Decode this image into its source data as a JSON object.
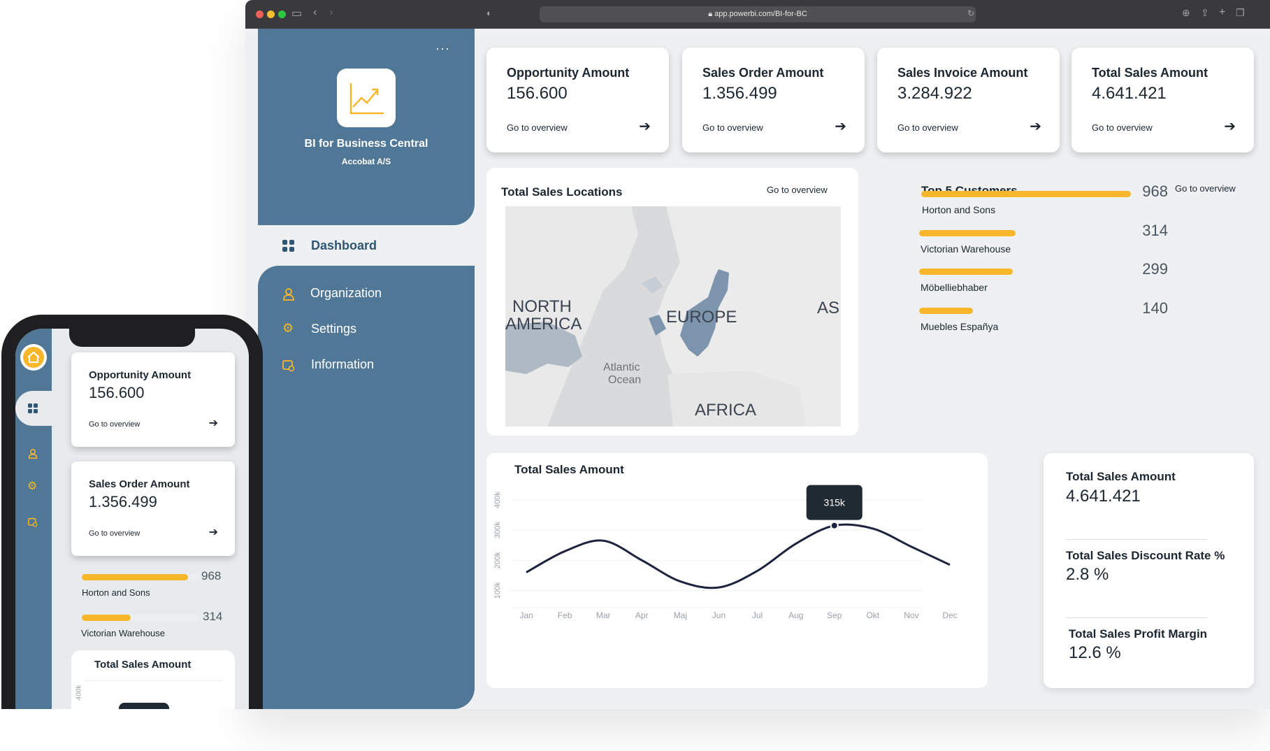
{
  "browser": {
    "url": "app.powerbi.com/BI-for-BC"
  },
  "brand": {
    "title": "BI for Business Central",
    "subtitle": "Accobat A/S",
    "more": "···"
  },
  "nav": {
    "items": [
      {
        "label": "Dashboard",
        "icon": "grid-icon"
      },
      {
        "label": "Organization",
        "icon": "user-icon"
      },
      {
        "label": "Settings",
        "icon": "gear-icon"
      },
      {
        "label": "Information",
        "icon": "info-icon"
      }
    ]
  },
  "kpis": [
    {
      "title": "Opportunity Amount",
      "value": "156.600",
      "link": "Go to overview"
    },
    {
      "title": "Sales Order Amount",
      "value": "1.356.499",
      "link": "Go to overview"
    },
    {
      "title": "Sales Invoice Amount",
      "value": "3.284.922",
      "link": "Go to overview"
    },
    {
      "title": "Total Sales Amount",
      "value": "4.641.421",
      "link": "Go to overview"
    }
  ],
  "map": {
    "title": "Total Sales Locations",
    "link": "Go to overview",
    "labels": {
      "north": "NORTH",
      "america": "AMERICA",
      "europe": "EUROPE",
      "asia": "ASI",
      "atlantic": "Atlantic",
      "ocean": "Ocean",
      "africa": "AFRICA"
    }
  },
  "customers": {
    "title": "Top 5 Customers",
    "link": "Go to overview",
    "items": [
      {
        "name": "Horton and Sons",
        "value": 968,
        "fraction": 0.74
      },
      {
        "name": "Victorian Warehouse",
        "value": 314,
        "fraction": 0.34
      },
      {
        "name": "Möbelliebhaber",
        "value": 299,
        "fraction": 0.33
      },
      {
        "name": "Muebles Españya",
        "value": 140,
        "fraction": 0.19
      }
    ]
  },
  "stats": [
    {
      "title": "Total Sales Amount",
      "value": "4.641.421"
    },
    {
      "title": "Total Sales Discount Rate %",
      "value": "2.8 %"
    },
    {
      "title": "Total Sales Profit Margin",
      "value": "12.6 %"
    }
  ],
  "phone": {
    "cards": [
      {
        "title": "Opportunity Amount",
        "value": "156.600",
        "link": "Go to overview"
      },
      {
        "title": "Sales Order Amount",
        "value": "1.356.499",
        "link": "Go to overview"
      }
    ],
    "customers": [
      {
        "name": "Horton and Sons",
        "value": 968
      },
      {
        "name": "Victorian Warehouse",
        "value": 314
      }
    ],
    "chart_title": "Total Sales Amount",
    "chart_tick": "400k"
  },
  "chart_data": {
    "type": "line",
    "title": "Total Sales Amount",
    "xlabel": "",
    "ylabel": "",
    "categories": [
      "Jan",
      "Feb",
      "Mar",
      "Apr",
      "Maj",
      "Jun",
      "Jul",
      "Aug",
      "Sep",
      "Okt",
      "Nov",
      "Dec"
    ],
    "ytick_labels": [
      "100k",
      "200k",
      "300k",
      "400k"
    ],
    "ylim": [
      50000,
      430000
    ],
    "series": [
      {
        "values": [
          160000,
          230000,
          265000,
          200000,
          130000,
          110000,
          165000,
          255000,
          315000,
          305000,
          245000,
          185000
        ]
      }
    ],
    "tooltip": {
      "label": "315k",
      "category": "Sep"
    },
    "grid": true,
    "line_color": "#1e2440"
  },
  "colors": {
    "sidebar": "#507896",
    "accent": "#f8b72a",
    "background": "#eef0f2"
  }
}
